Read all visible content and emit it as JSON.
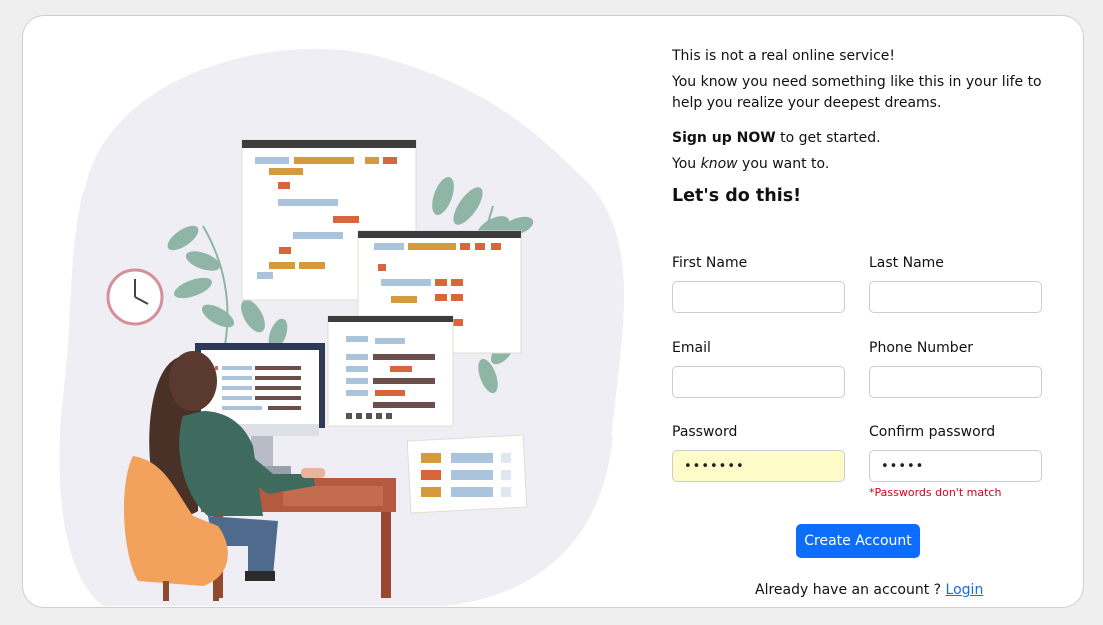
{
  "intro": {
    "line1": "This is not a real online service!",
    "line2": "You know you need something like this in your life to help you realize your deepest dreams.",
    "line3_bold": "Sign up NOW",
    "line3_rest": " to get started.",
    "line4_pre": "You ",
    "line4_italic": "know",
    "line4_post": " you want to."
  },
  "heading": "Let's do this!",
  "form": {
    "first_name_label": "First Name",
    "last_name_label": "Last Name",
    "email_label": "Email",
    "phone_label": "Phone Number",
    "password_label": "Password",
    "confirm_password_label": "Confirm password",
    "password_value_masked": "•••••••",
    "confirm_password_value_masked": "•••••",
    "error_message": "*Passwords don't match",
    "submit_label": "Create Account"
  },
  "footer": {
    "prompt": "Already have an account ? ",
    "login_link": "Login"
  },
  "colors": {
    "accent": "#0d6efd",
    "error": "#d0021b",
    "autofill": "#fdfbc8"
  },
  "icons": [
    "clock-icon",
    "plant-icon",
    "window-icon",
    "monitor-icon"
  ]
}
